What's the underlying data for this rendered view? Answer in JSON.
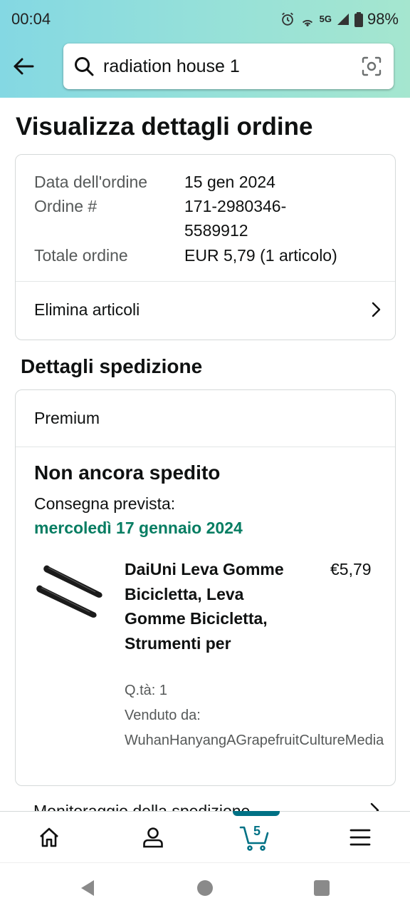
{
  "status_bar": {
    "time": "00:04",
    "network": "5G",
    "battery": "98%",
    "icons": [
      "alarm-icon",
      "hotspot-icon",
      "signal-icon",
      "battery-icon"
    ]
  },
  "search": {
    "query": "radiation house 1"
  },
  "page": {
    "title": "Visualizza dettagli ordine"
  },
  "order": {
    "date_label": "Data dell'ordine",
    "date_value": "15 gen 2024",
    "number_label": "Ordine #",
    "number_line1": "171-2980346-",
    "number_line2": "5589912",
    "total_label": "Totale ordine",
    "total_value": "EUR 5,79 (1 articolo)",
    "delete_items": "Elimina articoli"
  },
  "shipping": {
    "section_title": "Dettagli spedizione",
    "program": "Premium",
    "status": "Non ancora spedito",
    "delivery_label": "Consegna prevista:",
    "delivery_date": "mercoledì 17 gennaio 2024",
    "item": {
      "name": "DaiUni Leva Gomme Bicicletta, Leva Gomme Bicicletta, Strumenti per",
      "price": "€5,79",
      "quantity": "Q.tà: 1",
      "sold_by_label": "Venduto da:",
      "seller": "WuhanHanyangAGrapefruitCultureMedia"
    },
    "tracking_label": "Monitoraggio della spedizione"
  },
  "bottom_nav": {
    "cart_count": "5",
    "items": [
      "home-icon",
      "account-icon",
      "cart-icon",
      "menu-icon"
    ]
  },
  "colors": {
    "header_gradient_start": "#84d8e3",
    "header_gradient_end": "#a5e6cf",
    "delivery_green": "#067d62",
    "accent_teal": "#007185",
    "muted_text": "#565959"
  }
}
